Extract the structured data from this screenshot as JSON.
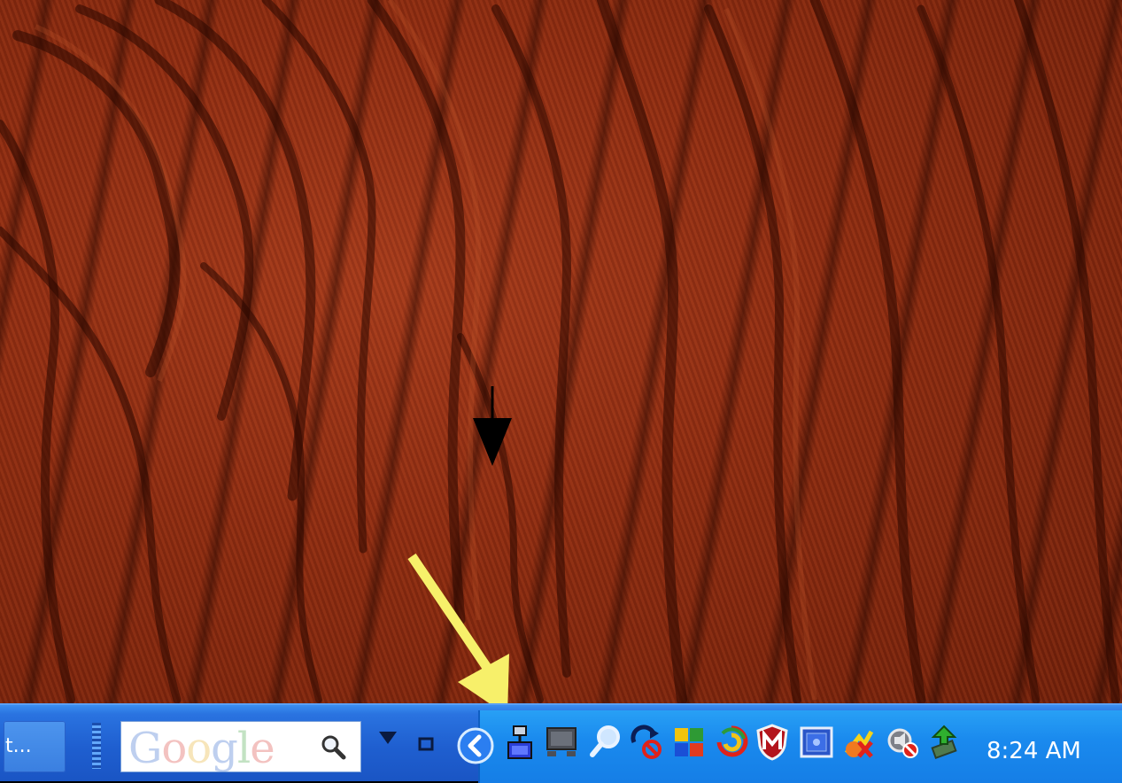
{
  "taskbar": {
    "task_button_label": "t...",
    "google_search": {
      "logo_letters": [
        "G",
        "o",
        "o",
        "g",
        "l",
        "e"
      ]
    },
    "tray_icons": [
      "show-hidden-icons-chevron-icon",
      "network-connection-icon",
      "display-icon",
      "search-magnifier-icon",
      "sync-blocked-icon",
      "windows-flag-icon",
      "spiral-app-icon",
      "mcafee-shield-icon",
      "antivirus-panel-icon",
      "power-alert-icon",
      "speaker-muted-icon",
      "safely-remove-hardware-icon"
    ],
    "clock": "8:24 AM"
  },
  "colors": {
    "taskbar": "#1f5fd0",
    "tray": "#1a8aee",
    "desktop_sand": "#8a2a10",
    "callout_arrow": "#f7f06a"
  }
}
